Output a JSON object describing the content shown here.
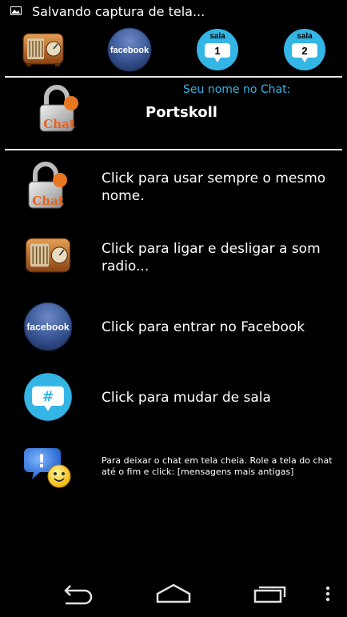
{
  "status_bar": {
    "notification_text": "Salvando captura de tela...",
    "icon": "image-icon"
  },
  "toolbar": {
    "radio_icon": "radio-icon",
    "facebook_label": "facebook",
    "sala1": {
      "label": "sala",
      "number": "1"
    },
    "sala2": {
      "label": "sala",
      "number": "2"
    }
  },
  "chat_header": {
    "label": "Seu nome no Chat:",
    "name": "Portskoll",
    "lock_text": "Chat"
  },
  "list": {
    "same_name": {
      "text": "Click para usar sempre o mesmo nome.",
      "icon_text": "Chat"
    },
    "radio": {
      "text": "Click  para ligar e desligar a som radio..."
    },
    "facebook": {
      "text": "Click para entrar no Facebook",
      "icon_text": "facebook"
    },
    "room": {
      "text": "Click para mudar de sala",
      "icon_text": "#"
    },
    "fullscreen": {
      "text": "Para deixar o chat em tela cheia. Role a tela do chat até o fim e click: [mensagens mais antigas]"
    }
  },
  "nav": {
    "back": "back-icon",
    "home": "home-icon",
    "recents": "recents-icon",
    "menu": "overflow-menu-icon"
  },
  "colors": {
    "accent_blue": "#33b5e5",
    "facebook_blue": "#3b5998",
    "divider": "#e8e8e8"
  }
}
